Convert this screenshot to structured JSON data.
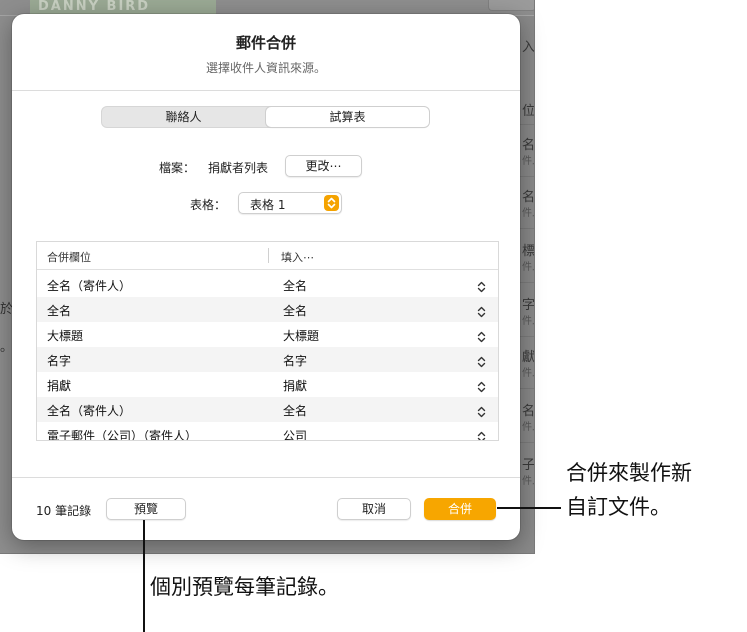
{
  "background": {
    "logo_text": "DANNY BIRD",
    "side_items": [
      "入人",
      "位",
      "名",
      "件人",
      "名",
      "件人",
      "標",
      "件人",
      "字",
      "件人",
      "獻",
      "件人",
      "名",
      "件人",
      "子",
      "件人"
    ],
    "left_text_1": "於",
    "left_text_2": "。"
  },
  "dialog": {
    "title": "郵件合併",
    "subtitle": "選擇收件人資訊來源。",
    "source_tabs": [
      {
        "label": "聯絡人",
        "selected": false
      },
      {
        "label": "試算表",
        "selected": true
      }
    ],
    "file_label": "檔案：",
    "file_name": "捐獻者列表",
    "change_button": "更改⋯",
    "table_label": "表格：",
    "table_value": "表格 1",
    "columns": {
      "merge_field": "合併欄位",
      "fill_with": "填入⋯"
    },
    "rows": [
      {
        "field": "全名（寄件人）",
        "value": "全名"
      },
      {
        "field": "全名",
        "value": "全名"
      },
      {
        "field": "大標題",
        "value": "大標題"
      },
      {
        "field": "名字",
        "value": "名字"
      },
      {
        "field": "捐獻",
        "value": "捐獻"
      },
      {
        "field": "全名（寄件人）",
        "value": "全名"
      },
      {
        "field": "電子郵件（公司）（寄件人）",
        "value": "公司"
      }
    ],
    "record_count": "10 筆記錄",
    "preview_button": "預覽",
    "cancel_button": "取消",
    "merge_button": "合併"
  },
  "callouts": {
    "merge_line1": "合併來製作新",
    "merge_line2": "自訂文件。",
    "preview": "個別預覽每筆記錄。"
  },
  "colors": {
    "accent": "#f7a600",
    "dim_background": "#8e8e8e"
  }
}
